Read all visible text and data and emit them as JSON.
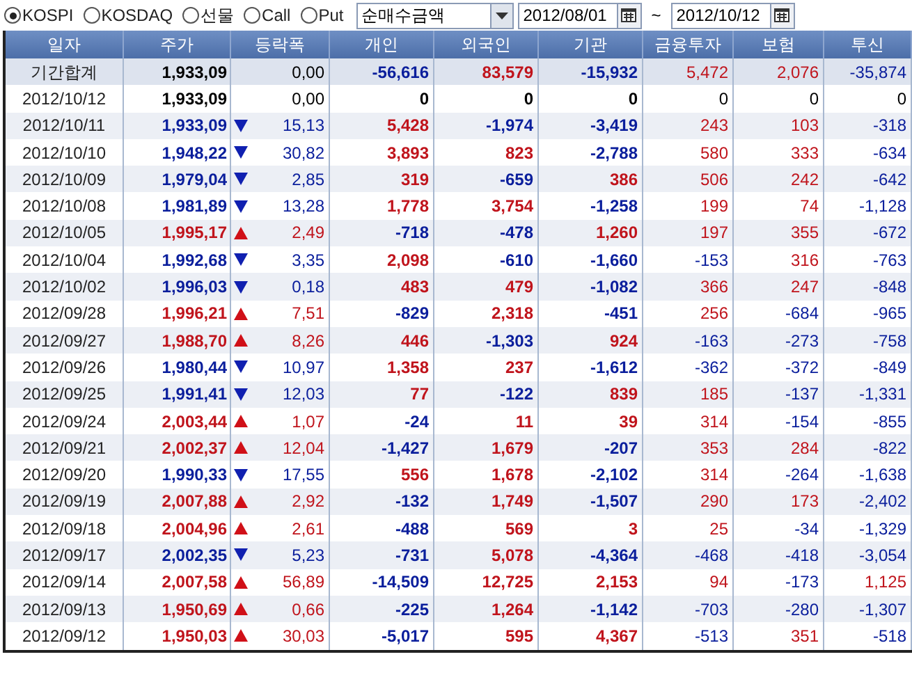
{
  "toolbar": {
    "markets": [
      {
        "label": "KOSPI",
        "selected": true
      },
      {
        "label": "KOSDAQ",
        "selected": false
      },
      {
        "label": "선물",
        "selected": false
      },
      {
        "label": "Call",
        "selected": false
      },
      {
        "label": "Put",
        "selected": false
      }
    ],
    "measure": {
      "value": "순매수금액"
    },
    "date_from": {
      "value": "2012/08/01"
    },
    "separator": "~",
    "date_to": {
      "value": "2012/10/12"
    }
  },
  "table": {
    "columns": [
      "일자",
      "주가",
      "등락폭",
      "개인",
      "외국인",
      "기관",
      "금융투자",
      "보험",
      "투신"
    ],
    "summary": {
      "date": "기간합계",
      "price": "1,933,09",
      "change": "0,00",
      "values": [
        "-56,616",
        "83,579",
        "-15,932",
        "5,472",
        "2,076",
        "-35,874"
      ]
    },
    "rows": [
      {
        "date": "2012/10/12",
        "price": "1,933,09",
        "kind": "flat",
        "change": "0,00",
        "values": [
          "0",
          "0",
          "0",
          "0",
          "0",
          "0"
        ]
      },
      {
        "date": "2012/10/11",
        "price": "1,933,09",
        "kind": "down",
        "change": "15,13",
        "values": [
          "5,428",
          "-1,974",
          "-3,419",
          "243",
          "103",
          "-318"
        ]
      },
      {
        "date": "2012/10/10",
        "price": "1,948,22",
        "kind": "down",
        "change": "30,82",
        "values": [
          "3,893",
          "823",
          "-2,788",
          "580",
          "333",
          "-634"
        ]
      },
      {
        "date": "2012/10/09",
        "price": "1,979,04",
        "kind": "down",
        "change": "2,85",
        "values": [
          "319",
          "-659",
          "386",
          "506",
          "242",
          "-642"
        ]
      },
      {
        "date": "2012/10/08",
        "price": "1,981,89",
        "kind": "down",
        "change": "13,28",
        "values": [
          "1,778",
          "3,754",
          "-1,258",
          "199",
          "74",
          "-1,128"
        ]
      },
      {
        "date": "2012/10/05",
        "price": "1,995,17",
        "kind": "up",
        "change": "2,49",
        "values": [
          "-718",
          "-478",
          "1,260",
          "197",
          "355",
          "-672"
        ]
      },
      {
        "date": "2012/10/04",
        "price": "1,992,68",
        "kind": "down",
        "change": "3,35",
        "values": [
          "2,098",
          "-610",
          "-1,660",
          "-153",
          "316",
          "-763"
        ]
      },
      {
        "date": "2012/10/02",
        "price": "1,996,03",
        "kind": "down",
        "change": "0,18",
        "values": [
          "483",
          "479",
          "-1,082",
          "366",
          "247",
          "-848"
        ]
      },
      {
        "date": "2012/09/28",
        "price": "1,996,21",
        "kind": "up",
        "change": "7,51",
        "values": [
          "-829",
          "2,318",
          "-451",
          "256",
          "-684",
          "-965"
        ]
      },
      {
        "date": "2012/09/27",
        "price": "1,988,70",
        "kind": "up",
        "change": "8,26",
        "values": [
          "446",
          "-1,303",
          "924",
          "-163",
          "-273",
          "-758"
        ]
      },
      {
        "date": "2012/09/26",
        "price": "1,980,44",
        "kind": "down",
        "change": "10,97",
        "values": [
          "1,358",
          "237",
          "-1,612",
          "-362",
          "-372",
          "-849"
        ]
      },
      {
        "date": "2012/09/25",
        "price": "1,991,41",
        "kind": "down",
        "change": "12,03",
        "values": [
          "77",
          "-122",
          "839",
          "185",
          "-137",
          "-1,331"
        ]
      },
      {
        "date": "2012/09/24",
        "price": "2,003,44",
        "kind": "up",
        "change": "1,07",
        "values": [
          "-24",
          "11",
          "39",
          "314",
          "-154",
          "-855"
        ]
      },
      {
        "date": "2012/09/21",
        "price": "2,002,37",
        "kind": "up",
        "change": "12,04",
        "values": [
          "-1,427",
          "1,679",
          "-207",
          "353",
          "284",
          "-822"
        ]
      },
      {
        "date": "2012/09/20",
        "price": "1,990,33",
        "kind": "down",
        "change": "17,55",
        "values": [
          "556",
          "1,678",
          "-2,102",
          "314",
          "-264",
          "-1,638"
        ]
      },
      {
        "date": "2012/09/19",
        "price": "2,007,88",
        "kind": "up",
        "change": "2,92",
        "values": [
          "-132",
          "1,749",
          "-1,507",
          "290",
          "173",
          "-2,402"
        ]
      },
      {
        "date": "2012/09/18",
        "price": "2,004,96",
        "kind": "up",
        "change": "2,61",
        "values": [
          "-488",
          "569",
          "3",
          "25",
          "-34",
          "-1,329"
        ]
      },
      {
        "date": "2012/09/17",
        "price": "2,002,35",
        "kind": "down",
        "change": "5,23",
        "values": [
          "-731",
          "5,078",
          "-4,364",
          "-468",
          "-418",
          "-3,054"
        ]
      },
      {
        "date": "2012/09/14",
        "price": "2,007,58",
        "kind": "up",
        "change": "56,89",
        "values": [
          "-14,509",
          "12,725",
          "2,153",
          "94",
          "-173",
          "1,125"
        ]
      },
      {
        "date": "2012/09/13",
        "price": "1,950,69",
        "kind": "up",
        "change": "0,66",
        "values": [
          "-225",
          "1,264",
          "-1,142",
          "-703",
          "-280",
          "-1,307"
        ]
      },
      {
        "date": "2012/09/12",
        "price": "1,950,03",
        "kind": "up",
        "change": "30,03",
        "values": [
          "-5,017",
          "595",
          "4,367",
          "-513",
          "351",
          "-518"
        ]
      }
    ]
  }
}
